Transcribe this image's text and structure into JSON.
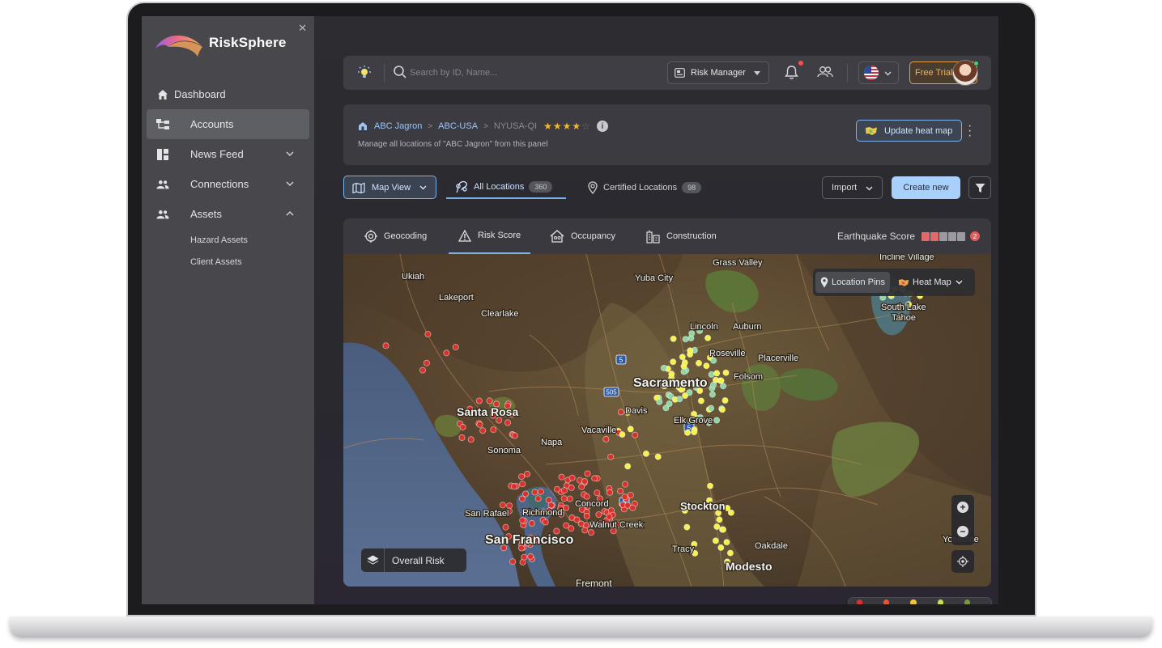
{
  "app": {
    "name": "RiskSphere"
  },
  "sidebar": {
    "items": [
      {
        "label": "Dashboard"
      },
      {
        "label": "Accounts"
      },
      {
        "label": "News Feed"
      },
      {
        "label": "Connections"
      },
      {
        "label": "Assets"
      }
    ],
    "sub_items": [
      {
        "label": "Hazard Assets"
      },
      {
        "label": "Client Assets"
      }
    ]
  },
  "topbar": {
    "search_placeholder": "Search by ID, Name...",
    "role": "Risk Manager",
    "trial": "Free Trial"
  },
  "breadcrumb": {
    "items": [
      "ABC Jagron",
      "ABC-USA",
      "NYUSA-QI"
    ],
    "rating": 4,
    "rating_max": 5,
    "description": "Manage all locations of \"ABC Jagron\" from this panel",
    "update_button": "Update heat map"
  },
  "toolbar": {
    "map_view": "Map View",
    "all_locations": "All Locations",
    "all_count": "360",
    "certified": "Certified Locations",
    "certified_count": "98",
    "import": "Import",
    "create": "Create new"
  },
  "map_tabs": [
    "Geocoding",
    "Risk Score",
    "Occupancy",
    "Construction"
  ],
  "earthquake": {
    "label": "Earthquake Score",
    "badge": "2",
    "levels": [
      "#e06a6a",
      "#e06a6a",
      "#9a9aa0",
      "#9a9aa0",
      "#9a9aa0"
    ]
  },
  "map": {
    "pins_label": "Location Pins",
    "heat_label": "Heat Map",
    "overall_label": "Overall Risk",
    "labels": [
      {
        "text": "Ukiah"
      },
      {
        "text": "Lakeport"
      },
      {
        "text": "Clearlake"
      },
      {
        "text": "Yuba City"
      },
      {
        "text": "Grass Valley"
      },
      {
        "text": "Incline Village"
      },
      {
        "text": "South Lake"
      },
      {
        "text": "Tahoe"
      },
      {
        "text": "Lincoln"
      },
      {
        "text": "Auburn"
      },
      {
        "text": "Roseville"
      },
      {
        "text": "Placerville"
      },
      {
        "text": "Sacramento"
      },
      {
        "text": "Folsom"
      },
      {
        "text": "Davis"
      },
      {
        "text": "Elk Grove"
      },
      {
        "text": "Santa Rosa"
      },
      {
        "text": "Vacaville"
      },
      {
        "text": "Napa"
      },
      {
        "text": "Sonoma"
      },
      {
        "text": "Concord"
      },
      {
        "text": "San Rafael"
      },
      {
        "text": "Richmond"
      },
      {
        "text": "Walnut Creek"
      },
      {
        "text": "San Francisco"
      },
      {
        "text": "Stockton"
      },
      {
        "text": "Tracy"
      },
      {
        "text": "Oakdale"
      },
      {
        "text": "Modesto"
      },
      {
        "text": "Fremont"
      },
      {
        "text": "Yosemite"
      }
    ],
    "highway_labels": [
      "5",
      "505",
      "5",
      "5"
    ]
  },
  "colors": {
    "accent": "#7fb2ea",
    "primary_button": "#a9d0fb",
    "trial": "#f0b25c",
    "star": "#f5b72a",
    "pin_red": "#d9312b",
    "pin_yellow": "#f7f24a",
    "pin_green": "#8fd6a4"
  }
}
